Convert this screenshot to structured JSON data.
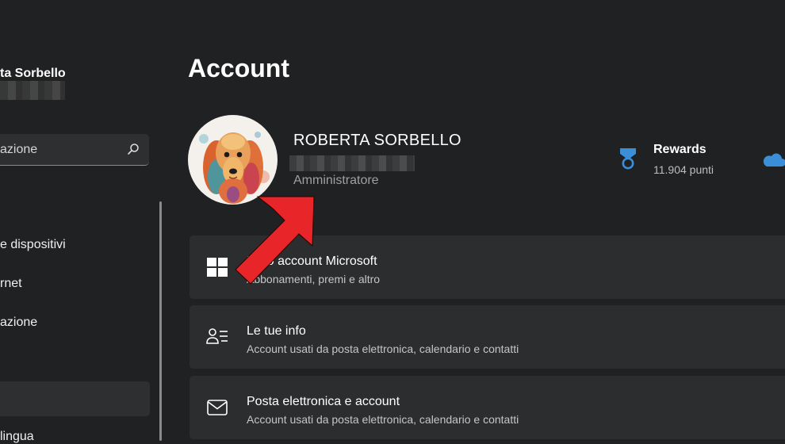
{
  "sidebar": {
    "user_name": "ta Sorbello",
    "search_placeholder": "azione",
    "items": [
      {
        "label": "e dispositivi"
      },
      {
        "label": "rnet"
      },
      {
        "label": "azione"
      },
      {
        "label": "lingua"
      }
    ]
  },
  "main": {
    "title": "Account",
    "profile": {
      "name": "ROBERTA SORBELLO",
      "role": "Amministratore"
    },
    "rewards": {
      "title": "Rewards",
      "points": "11.904 punti"
    },
    "cards": [
      {
        "title": "Il tuo account Microsoft",
        "subtitle": "Abbonamenti, premi e altro",
        "icon": "windows-logo-icon"
      },
      {
        "title": "Le tue info",
        "subtitle": "Account usati da posta elettronica, calendario e contatti",
        "icon": "user-info-icon"
      },
      {
        "title": "Posta elettronica e account",
        "subtitle": "Account usati da posta elettronica, calendario e contatti",
        "icon": "mail-icon"
      }
    ]
  },
  "colors": {
    "background": "#1f2123",
    "card": "#2b2d2f",
    "accent_blue": "#3b8fd8",
    "arrow_red": "#e8262a"
  }
}
